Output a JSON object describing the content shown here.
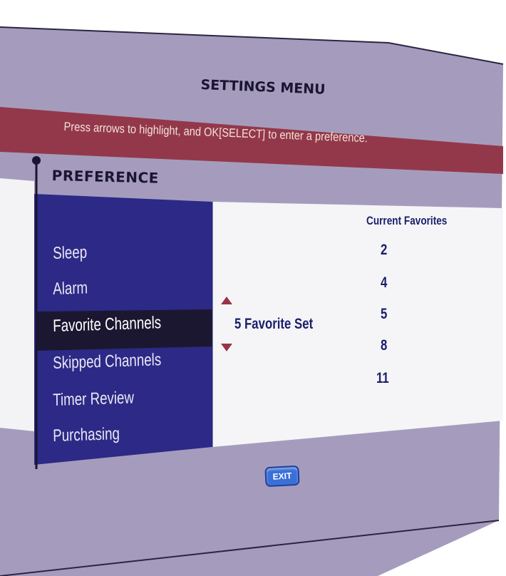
{
  "header": {
    "title": "SETTINGS MENU"
  },
  "instruction": {
    "text": "Press arrows to highlight, and OK[SELECT] to enter a preference."
  },
  "section": {
    "label": "PREFERENCE"
  },
  "menu": {
    "items": [
      {
        "label": "Sleep"
      },
      {
        "label": "Alarm"
      },
      {
        "label": "Favorite Channels",
        "selected": true
      },
      {
        "label": "Skipped Channels"
      },
      {
        "label": "Timer Review"
      },
      {
        "label": "Purchasing"
      }
    ]
  },
  "detail": {
    "value_label": "5 Favorite Set",
    "favorites_header": "Current Favorites",
    "favorites": [
      "2",
      "4",
      "5",
      "8",
      "11"
    ]
  },
  "footer": {
    "exit_label": "EXIT"
  },
  "colors": {
    "frame": "#a59cbd",
    "banner": "#93384a",
    "menu_bg": "#2c2a86",
    "selected_bg": "#1b1730",
    "detail_bg": "#f5f5f8",
    "text_navy": "#1b1f6a",
    "exit_button": "#3a6fd8",
    "arrow": "#9a3346"
  }
}
